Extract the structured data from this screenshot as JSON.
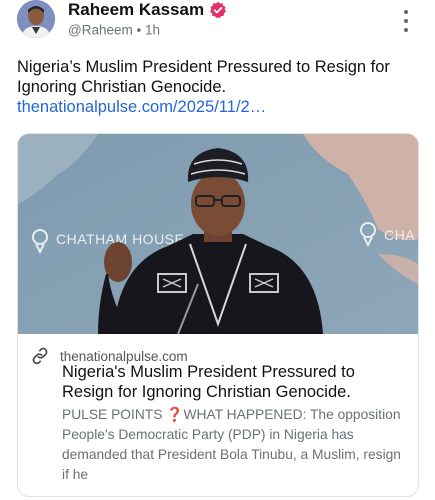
{
  "author": {
    "display_name": "Raheem Kassam",
    "handle": "@Raheem",
    "separator": "•",
    "age": "1h",
    "verified": true
  },
  "post": {
    "text": "Nigeria’s Muslim President Pressured to Resign for Ignoring Christian Genocide.",
    "link_text": "thenationalpulse.com/2025/11/2…"
  },
  "card": {
    "domain": "thenationalpulse.com",
    "title": "Nigeria's Muslim President Pressured to Resign for Ignoring Christian Genocide.",
    "desc_prefix": "PULSE POINTS",
    "desc_emoji": "❓",
    "desc_body": "WHAT HAPPENED: The opposition People's Democratic Party (PDP) in Nigeria has demanded that President Bola Tinubu, a Muslim, resign if he",
    "image_caption_left": "CHATHAM HOUSE",
    "image_caption_right": "CHA"
  },
  "colors": {
    "link": "#2467d8",
    "verified_badge": "#e1306c",
    "muted_text": "#6b7078"
  },
  "icons": [
    "verified-badge-icon",
    "more-options-icon",
    "link-icon"
  ]
}
